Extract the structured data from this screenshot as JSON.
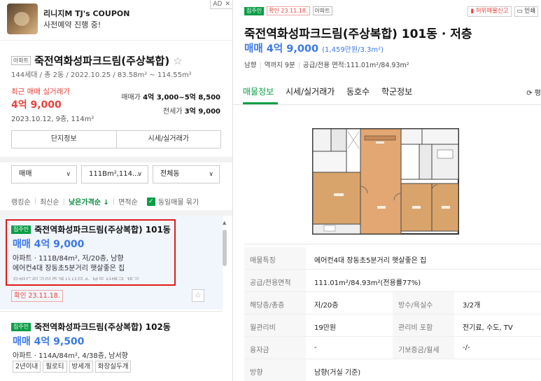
{
  "ad": {
    "title": "리니지M TJ's COUPON",
    "subtitle": "사전예약 진행 중!",
    "badge_ad": "AD",
    "badge_close": "✕"
  },
  "summary": {
    "type_tag": "아파트",
    "title": "죽전역화성파크드림(주상복합)",
    "star": "☆",
    "meta": "144세대 / 총 2동 / 2022.10.25 / 83.58m² ~ 114.55m²",
    "recent_label": "최근 매매 실거래가",
    "recent_price": "4억 9,000",
    "recent_date": "2023.10.12, 9층, 114m²",
    "sale_label": "매매가",
    "sale_value": "4억 3,000~5억 8,500",
    "jeonse_label": "전세가",
    "jeonse_value": "3억 9,000",
    "btn_complex": "단지정보",
    "btn_price": "시세/실거래가"
  },
  "filters": {
    "deal": "매매",
    "area": "111Bm²,114...",
    "dong": "전체동",
    "chevron": "∨"
  },
  "sorts": {
    "ranking": "랭킹순",
    "latest": "최신순",
    "low_price": "낮은가격순 ↓",
    "area": "면적순",
    "same_bundle": "동일매물 묶기",
    "check": "✓"
  },
  "listings": [
    {
      "tag": "집주인",
      "name": "죽전역화성파크드림(주상복합) 101동",
      "deal": "매매",
      "price": "4억 9,000",
      "spec": "아파트 · 111B/84m², 저/20층, 남향",
      "desc": "에어컨4대 장동초5분거리 햇살좋은 집",
      "cut": "우방드림공인중개사사무소    부동산뱅크 제공",
      "confirm": "확인 23.11.18.",
      "star": "☆"
    },
    {
      "tag": "집주인",
      "name": "죽전역화성파크드림(주상복합) 102동",
      "deal": "매매",
      "price": "4억 9,500",
      "spec": "아파트 · 114A/84m², 4/38층, 남서향",
      "chips": [
        "2년이내",
        "필로티",
        "방세개",
        "화장실두개"
      ]
    }
  ],
  "detail": {
    "tag_owner": "집주인",
    "tag_confirm": "확인 23.11.18.",
    "tag_type": "아파트",
    "act_report": "허위매물신고",
    "act_print": "인쇄",
    "title": "죽전역화성파크드림(주상복합) 101동 · 저층",
    "deal": "매매",
    "price": "4억 9,000",
    "per_area": "(1,459만원/3.3m²)",
    "meta_direction": "남향",
    "meta_station": "역까지 9분",
    "meta_area": "공급/전용 면적:111.01m²/84.93m²",
    "tabs": [
      "매물정보",
      "시세/실거래가",
      "동호수",
      "학군정보"
    ],
    "refresh": "⟳ 평",
    "info": [
      {
        "k": "매물특징",
        "v": "에어컨4대 장동초5분거리 햇살좋은 집"
      },
      {
        "k": "공급/전용면적",
        "v": "111.01m²/84.93m²(전용률77%)"
      },
      {
        "k": "해당층/총층",
        "v": "저/20층",
        "k2": "방수/욕실수",
        "v2": "3/2개"
      },
      {
        "k": "월관리비",
        "v": "19만원",
        "k2": "관리비 포함",
        "v2": "전기료, 수도, TV"
      },
      {
        "k": "융자금",
        "v": "-",
        "k2": "기보증금/월세",
        "v2": "-/-"
      },
      {
        "k": "방향",
        "v": "남향(거실 기준)"
      }
    ]
  }
}
